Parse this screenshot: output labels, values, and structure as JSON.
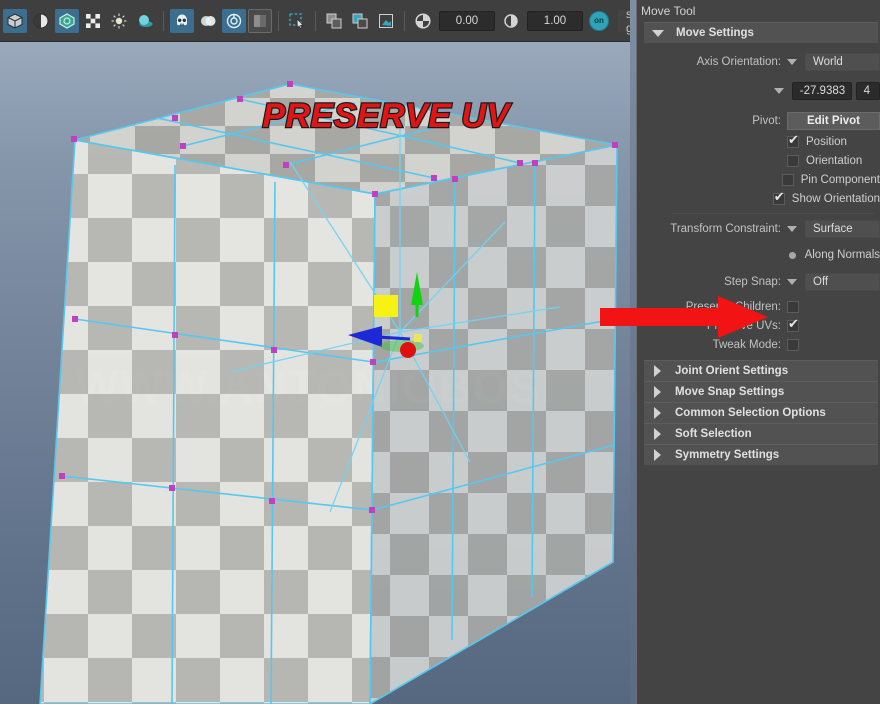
{
  "toolbar": {
    "icons": [
      {
        "name": "shaded-cube-icon",
        "state": "active"
      },
      {
        "name": "wireframe-shaded-icon",
        "state": "normal"
      },
      {
        "name": "textured-icon",
        "state": "active"
      },
      {
        "name": "checker-texture-icon",
        "state": "normal"
      },
      {
        "name": "lighting-bulb-icon",
        "state": "normal"
      },
      {
        "name": "shadows-sphere-icon",
        "state": "normal"
      },
      {
        "name": "xray-skull-icon",
        "state": "active"
      },
      {
        "name": "xray-joints-icon",
        "state": "normal"
      },
      {
        "name": "screen-space-ao-icon",
        "state": "active"
      },
      {
        "name": "motion-blur-icon",
        "state": "frame"
      },
      {
        "name": "isolate-select-icon",
        "state": "normal"
      },
      {
        "name": "grid-toggle-icon",
        "state": "normal"
      },
      {
        "name": "film-gate-icon",
        "state": "normal"
      },
      {
        "name": "resolution-gate-icon",
        "state": "normal"
      }
    ],
    "exposure_value": "0.00",
    "gamma_value": "1.00",
    "gamma_toggle_label": "on",
    "colorspace_value": "sRGB gamma",
    "colorspace_dropdown": "chevron-down-icon"
  },
  "viewport": {
    "title_overlay": "PRESERVE UV",
    "watermark_left": "WWW.ANTONIOBOSI",
    "watermark_right": ".COM",
    "manipulator": {
      "y_axis_color": "#11d411",
      "x_axis_color": "#1d29d8",
      "z_axis_color": "#e01010",
      "handle_color": "#f6f213",
      "center_color": "#e8e85a"
    },
    "wire_color": "#55c8f0",
    "vertex_color": "#c040c0",
    "annotation_arrow_color": "#f21414"
  },
  "panel": {
    "tool_title": "Move Tool",
    "move_settings": {
      "header": "Move Settings",
      "axis_orientation_label": "Axis Orientation:",
      "axis_orientation_value": "World",
      "axis_angle_value": "-27.9383",
      "axis_angle_value2": "4",
      "pivot_label": "Pivot:",
      "pivot_button": "Edit Pivot",
      "pivot_checks": [
        {
          "label": "Position",
          "checked": true
        },
        {
          "label": "Orientation",
          "checked": false
        },
        {
          "label": "Pin Component",
          "checked": false
        },
        {
          "label": "Show Orientation",
          "checked": true
        }
      ],
      "transform_constraint_label": "Transform Constraint:",
      "transform_constraint_value": "Surface",
      "along_normals_label": "Along Normals",
      "step_snap_label": "Step Snap:",
      "step_snap_value": "Off",
      "toggles": [
        {
          "label": "Preserve Children:",
          "checked": false
        },
        {
          "label": "Preserve UVs:",
          "checked": true
        },
        {
          "label": "Tweak Mode:",
          "checked": false
        }
      ]
    },
    "collapsed_sections": [
      "Joint Orient Settings",
      "Move Snap Settings",
      "Common Selection Options",
      "Soft Selection",
      "Symmetry Settings"
    ]
  }
}
